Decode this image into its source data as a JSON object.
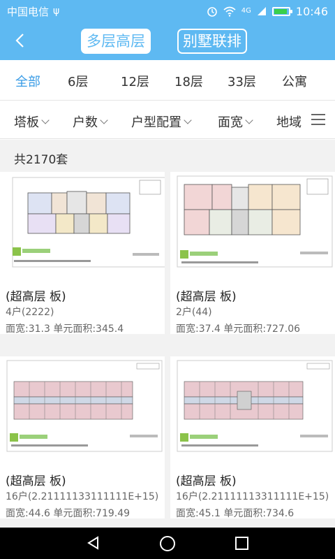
{
  "status_bar": {
    "carrier": "中国电信",
    "usb": "ψ",
    "network": "4G",
    "time": "10:46"
  },
  "header": {
    "back_icon": "chevron-left-icon",
    "tabs": [
      {
        "label": "多层高层",
        "active": true
      },
      {
        "label": "别墅联排",
        "active": false
      }
    ]
  },
  "floor_tabs": [
    {
      "label": "全部",
      "active": true
    },
    {
      "label": "6层",
      "active": false
    },
    {
      "label": "12层",
      "active": false
    },
    {
      "label": "18层",
      "active": false
    },
    {
      "label": "33层",
      "active": false
    },
    {
      "label": "公寓",
      "active": false
    }
  ],
  "filters": [
    {
      "label": "塔板"
    },
    {
      "label": "户数"
    },
    {
      "label": "户型配置"
    },
    {
      "label": "面宽"
    },
    {
      "label": "地域"
    }
  ],
  "result_count": "共2170套",
  "listings": [
    {
      "title": "(超高层  板)",
      "units": "4户(2222)",
      "specs": "面宽:31.3 单元面积:345.4"
    },
    {
      "title": "(超高层  板)",
      "units": "2户(44)",
      "specs": "面宽:37.4 单元面积:727.06"
    },
    {
      "title": "(超高层  板)",
      "units": "16户(2.21111133111111E+15)",
      "specs": "面宽:44.6 单元面积:719.49"
    },
    {
      "title": "(超高层  板)",
      "units": "16户(2.21111113311111E+15)",
      "specs": "面宽:45.1 单元面积:734.6"
    }
  ],
  "colors": {
    "primary": "#5eb9f2",
    "active_tab": "#3a9ce6",
    "background": "#f2f2f2"
  }
}
